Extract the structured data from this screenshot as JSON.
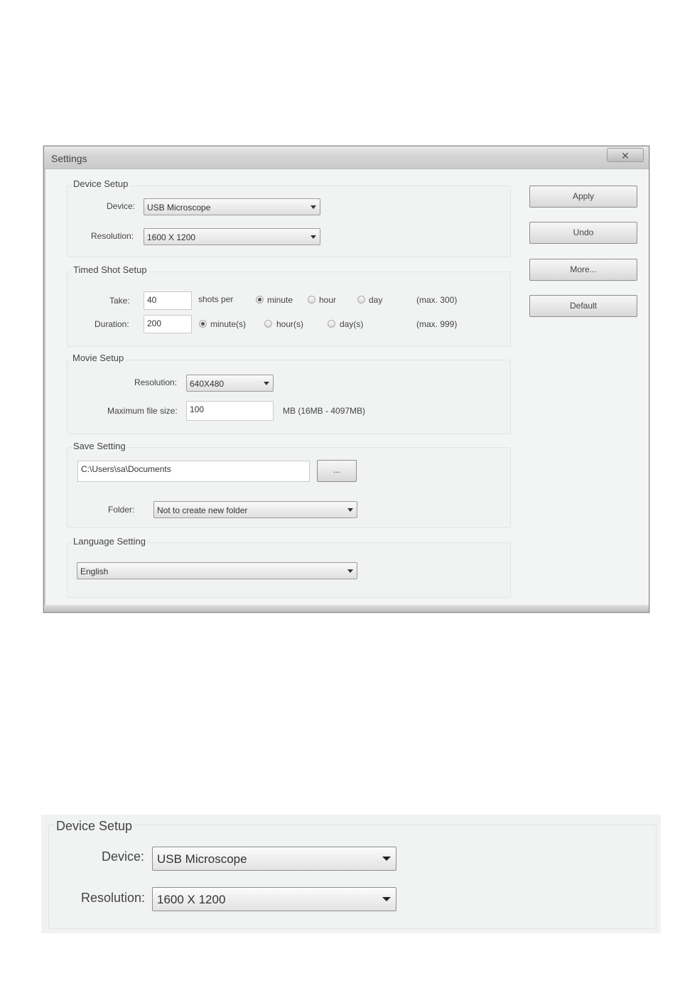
{
  "window": {
    "title": "Settings",
    "close_glyph": "✕"
  },
  "device_setup": {
    "title": "Device Setup",
    "device_label": "Device:",
    "device_value": "USB Microscope",
    "resolution_label": "Resolution:",
    "resolution_value": "1600 X 1200"
  },
  "timed_shot": {
    "title": "Timed Shot Setup",
    "take_label": "Take:",
    "take_value": "40",
    "shots_per_label": "shots per",
    "per_options": [
      "minute",
      "hour",
      "day"
    ],
    "per_selected": "minute",
    "take_max": "(max. 300)",
    "duration_label": "Duration:",
    "duration_value": "200",
    "duration_options": [
      "minute(s)",
      "hour(s)",
      "day(s)"
    ],
    "duration_selected": "minute(s)",
    "duration_max": "(max. 999)"
  },
  "movie_setup": {
    "title": "Movie Setup",
    "resolution_label": "Resolution:",
    "resolution_value": "640X480",
    "max_size_label": "Maximum file size:",
    "max_size_value": "100",
    "max_size_hint": "MB (16MB - 4097MB)"
  },
  "save_setting": {
    "title": "Save Setting",
    "path_value": "C:\\Users\\sa\\Documents",
    "browse_label": "...",
    "folder_label": "Folder:",
    "folder_value": "Not to create new folder"
  },
  "language_setting": {
    "title": "Language Setting",
    "language_value": "English"
  },
  "buttons": {
    "apply": "Apply",
    "undo": "Undo",
    "more": "More...",
    "default": "Default"
  },
  "zoom": {
    "title": "Device Setup",
    "device_label": "Device:",
    "device_value": "USB Microscope",
    "resolution_label": "Resolution:",
    "resolution_value": "1600 X 1200"
  },
  "icons": {
    "dropdown": "chevron-down-icon",
    "radio": "radio-icon",
    "close": "close-icon"
  }
}
